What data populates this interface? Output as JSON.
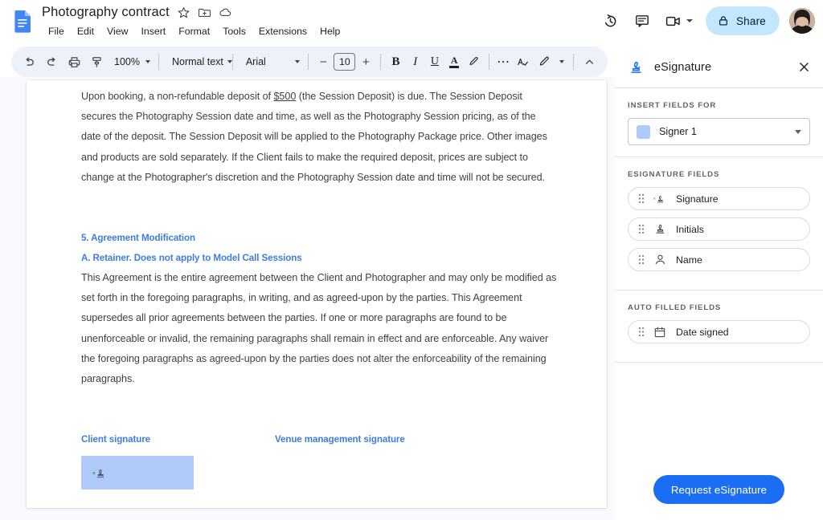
{
  "header": {
    "doc_icon": "google-docs-icon",
    "title": "Photography contract",
    "title_actions": [
      {
        "name": "star-icon",
        "label": "Star"
      },
      {
        "name": "move-folder-icon",
        "label": "Move"
      },
      {
        "name": "cloud-saved-icon",
        "label": "Saved to Drive"
      }
    ],
    "menu": [
      "File",
      "Edit",
      "View",
      "Insert",
      "Format",
      "Tools",
      "Extensions",
      "Help"
    ],
    "actions": [
      {
        "name": "version-history-icon",
        "label": "Version history"
      },
      {
        "name": "comment-icon",
        "label": "Open comment history"
      },
      {
        "name": "meet-icon",
        "label": "Join a call"
      }
    ],
    "share_label": "Share",
    "share_icon": "lock-icon",
    "avatar": "user-avatar"
  },
  "toolbar": {
    "undo": "undo-icon",
    "redo": "redo-icon",
    "print": "print-icon",
    "paint_format": "paint-format-icon",
    "zoom_value": "100%",
    "style_value": "Normal text",
    "font_value": "Arial",
    "font_size": "10",
    "decrease_label": "−",
    "increase_label": "+",
    "bold": "B",
    "italic": "I",
    "underline": "U",
    "text_color": "A",
    "highlight": "highlight-pen-icon",
    "more": "⋯",
    "spelling": "spellcheck-icon",
    "editing_mode": "pen-icon",
    "collapse": "chevron-up-icon"
  },
  "document": {
    "paragraph_1": "Upon booking, a non-refundable deposit of $500 (the Session Deposit) is due. The Session Deposit secures the Photography Session date and time, as well as the Photography Session pricing, as of the date of the deposit. The Session Deposit will be applied to the Photography Package price. Other images and products are sold separately. If the Client fails to make the required deposit, prices are subject to change at the Photographer's discretion and the Photography Session date and time will not be secured.",
    "p1_part_a": "Upon booking, a non-refundable deposit of ",
    "p1_underlined": "$500",
    "p1_part_b": " (the Session Deposit) is due. The Session Deposit secures the Photography Session date and time, as well as the Photography Session pricing, as of the date of the deposit. The Session Deposit will be applied to the Photography Package price. Other images and products are sold separately. If the Client fails to make the required deposit, prices are subject to change at the Photographer's discretion and the Photography Session date and time will not be secured.",
    "heading_1": "5. Agreement Modification",
    "heading_2": "A. Retainer.  Does not apply to Model Call Sessions",
    "paragraph_2": "This Agreement is the entire agreement between the Client and Photographer and may only be modified as set forth in the foregoing paragraphs, in writing, and as agreed-upon by the parties.  This Agreement supersedes all prior agreements between the parties. If one or more paragraphs are found to be unenforceable or invalid, the remaining paragraphs shall remain in effect and are enforceable. Any waiver the foregoing paragraphs as agreed-upon by the parties does not alter the enforceability of the remaining paragraphs.",
    "client_signature_label": "Client signature",
    "venue_signature_label": "Venue management signature",
    "signature_field_icon": "signature-icon",
    "signature_field_color": "#aecbfa"
  },
  "panel": {
    "icon": "esignature-icon",
    "title": "eSignature",
    "close_icon": "close-icon",
    "insert_fields_label": "Insert fields for",
    "signer_value": "Signer 1",
    "signer_color": "#aecbfa",
    "esignature_fields_label": "eSignature fields",
    "esignature_fields": [
      {
        "label": "Signature",
        "icon": "signature-icon"
      },
      {
        "label": "Initials",
        "icon": "initials-stamp-icon"
      },
      {
        "label": "Name",
        "icon": "person-icon"
      }
    ],
    "auto_filled_label": "Auto filled fields",
    "auto_filled_fields": [
      {
        "label": "Date signed",
        "icon": "calendar-icon"
      }
    ],
    "request_label": "Request eSignature"
  },
  "colors": {
    "accent_blue": "#1b6ef3",
    "heading_blue": "#3d7de0",
    "share_bg": "#c2e7ff",
    "toolbar_bg": "#edf2fa",
    "page_bg": "#f8fafd",
    "signer_swatch": "#aecbfa"
  }
}
